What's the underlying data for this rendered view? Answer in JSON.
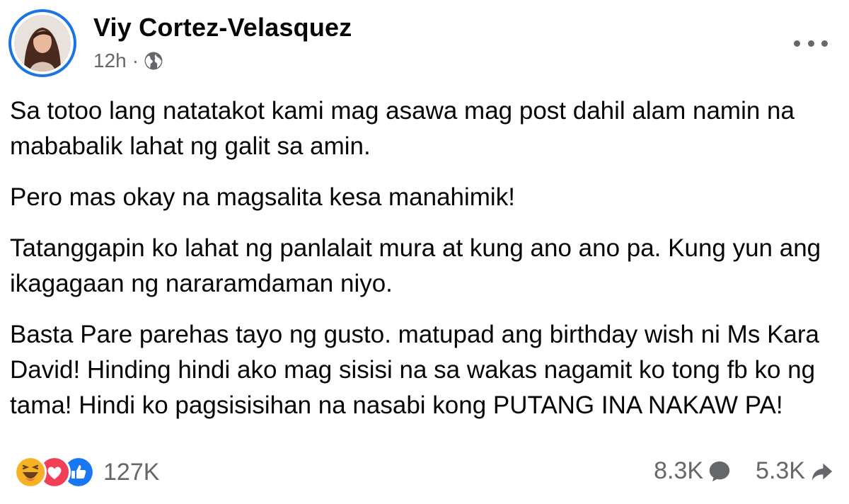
{
  "post": {
    "author": "Viy Cortez-Velasquez",
    "time": "12h",
    "separator": "·",
    "audience_icon": "globe-icon",
    "more_icon": "more-horizontal-icon",
    "paragraphs": [
      "Sa totoo lang natatakot kami mag asawa mag post dahil alam namin na mababalik lahat ng galit sa amin.",
      "Pero mas okay na magsalita kesa manahimik!",
      "Tatanggapin ko lahat ng panlalait mura at kung ano ano pa. Kung yun ang ikagagaan ng nararamdaman niyo.",
      "Basta Pare parehas tayo ng gusto. matupad ang birthday wish ni Ms Kara David! Hinding hindi ako mag sisisi na sa wakas nagamit ko tong fb ko ng tama! Hindi ko pagsisisihan na nasabi kong PUTANG INA NAKAW PA!"
    ]
  },
  "footer": {
    "reaction_icons": [
      "haha-icon",
      "love-icon",
      "like-icon"
    ],
    "reaction_count": "127K",
    "comment_count": "8.3K",
    "share_count": "5.3K"
  },
  "colors": {
    "accent": "#1b74e4",
    "text": "#050505",
    "secondary": "#65676b",
    "haha": "#f7b125",
    "love": "#f33e58",
    "like": "#1877f2"
  }
}
